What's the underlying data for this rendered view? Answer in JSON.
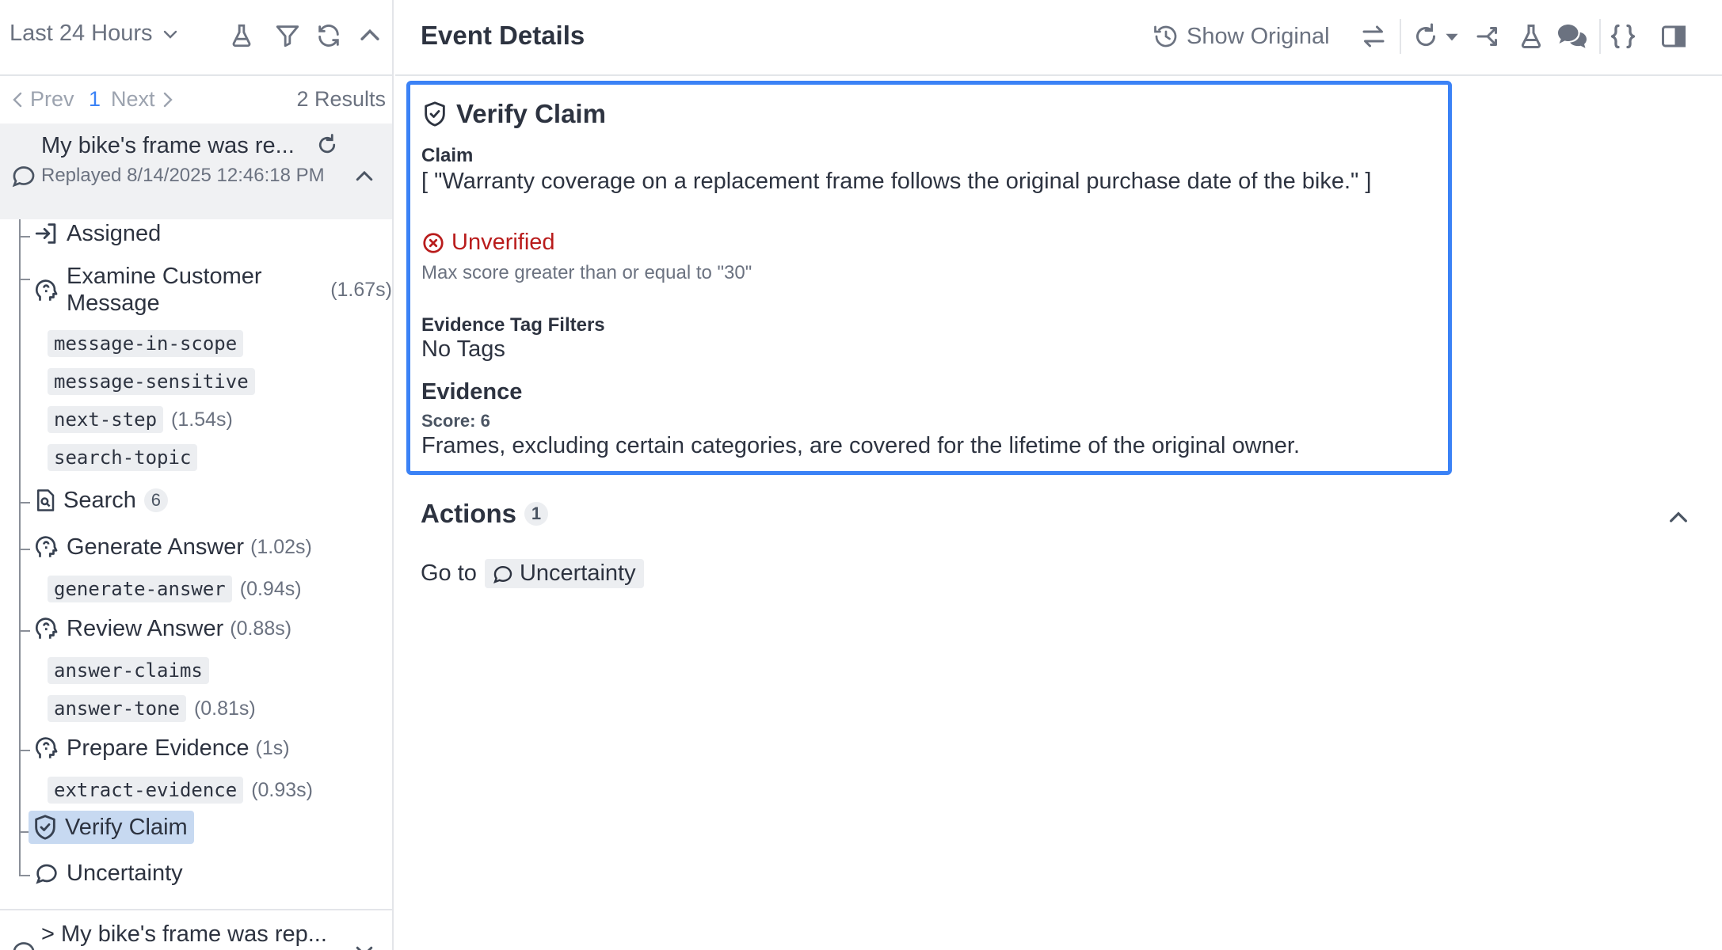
{
  "left_panel": {
    "time_filter": "Last 24 Hours",
    "pager": {
      "prev": "Prev",
      "page": "1",
      "next": "Next",
      "results": "2 Results"
    },
    "conversation": {
      "title": "My bike's frame was re...",
      "subtitle": "Replayed 8/14/2025 12:46:18 PM"
    },
    "tree": {
      "assigned": "Assigned",
      "examine": {
        "label": "Examine Customer Message",
        "duration": "(1.67s)"
      },
      "tag_message_in_scope": "message-in-scope",
      "tag_message_sensitive": "message-sensitive",
      "tag_next_step": {
        "label": "next-step",
        "duration": "(1.54s)"
      },
      "tag_search_topic": "search-topic",
      "search": {
        "label": "Search",
        "count": "6"
      },
      "generate": {
        "label": "Generate Answer",
        "duration": "(1.02s)"
      },
      "tag_generate_answer": {
        "label": "generate-answer",
        "duration": "(0.94s)"
      },
      "review": {
        "label": "Review Answer",
        "duration": "(0.88s)"
      },
      "tag_answer_claims": "answer-claims",
      "tag_answer_tone": {
        "label": "answer-tone",
        "duration": "(0.81s)"
      },
      "prepare": {
        "label": "Prepare Evidence",
        "duration": "(1s)"
      },
      "tag_extract_evidence": {
        "label": "extract-evidence",
        "duration": "(0.93s)"
      },
      "verify": "Verify Claim",
      "uncertainty": "Uncertainty"
    },
    "next_conversation": {
      "title": "> My bike's frame was rep..."
    }
  },
  "header": {
    "title": "Event Details",
    "show_original": "Show Original"
  },
  "card": {
    "title": "Verify Claim",
    "claim_label": "Claim",
    "claim_value": "[ \"Warranty coverage on a replacement frame follows the original purchase date of the bike.\" ]",
    "status": "Unverified",
    "status_detail": "Max score greater than or equal to \"30\"",
    "tag_filters_label": "Evidence Tag Filters",
    "tag_filters_value": "No Tags",
    "evidence_label": "Evidence",
    "evidence_score": "Score: 6",
    "evidence_text": "Frames, excluding certain categories, are covered for the lifetime of the original owner."
  },
  "actions": {
    "title": "Actions",
    "count": "1",
    "goto_prefix": "Go to",
    "goto_target": "Uncertainty"
  },
  "colors": {
    "accent": "#3b82f6",
    "error": "#b91c1c",
    "selected_bg": "#c7d9f1",
    "chip_bg": "#eceef1"
  }
}
